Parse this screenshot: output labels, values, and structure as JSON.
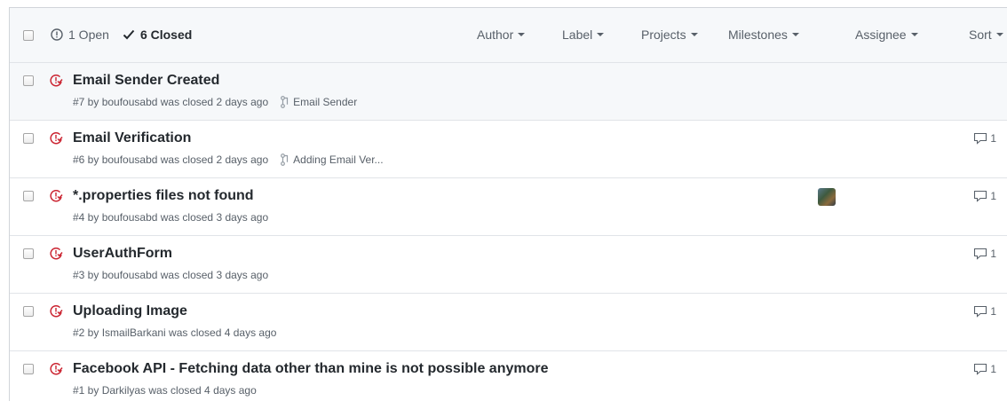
{
  "header": {
    "open_label": "1 Open",
    "closed_label": "6 Closed",
    "filters": [
      "Author",
      "Label",
      "Projects",
      "Milestones",
      "Assignee",
      "Sort"
    ]
  },
  "issues": [
    {
      "title": "Email Sender Created",
      "meta": "#7 by boufousabd was closed 2 days ago",
      "linked_pr": "Email Sender",
      "comments": ""
    },
    {
      "title": "Email Verification",
      "meta": "#6 by boufousabd was closed 2 days ago",
      "linked_pr": "Adding Email Ver...",
      "comments": "1"
    },
    {
      "title": "*.properties files not found",
      "meta": "#4 by boufousabd was closed 3 days ago",
      "linked_pr": "",
      "comments": "1"
    },
    {
      "title": "UserAuthForm",
      "meta": "#3 by boufousabd was closed 3 days ago",
      "linked_pr": "",
      "comments": "1"
    },
    {
      "title": "Uploading Image",
      "meta": "#2 by IsmailBarkani was closed 4 days ago",
      "linked_pr": "",
      "comments": "1"
    },
    {
      "title": "Facebook API - Fetching data other than mine is not possible anymore",
      "meta": "#1 by Darkilyas was closed 4 days ago",
      "linked_pr": "",
      "comments": "1"
    }
  ],
  "colors": {
    "closed_issue": "#cb2431",
    "text": "#24292e",
    "muted": "#586069"
  },
  "icons": {
    "open": "issue-opened-icon",
    "closed": "check-icon",
    "issue": "issue-closed-icon",
    "pr": "git-pull-request-icon",
    "comment": "comment-icon",
    "caret": "caret-down-icon"
  }
}
